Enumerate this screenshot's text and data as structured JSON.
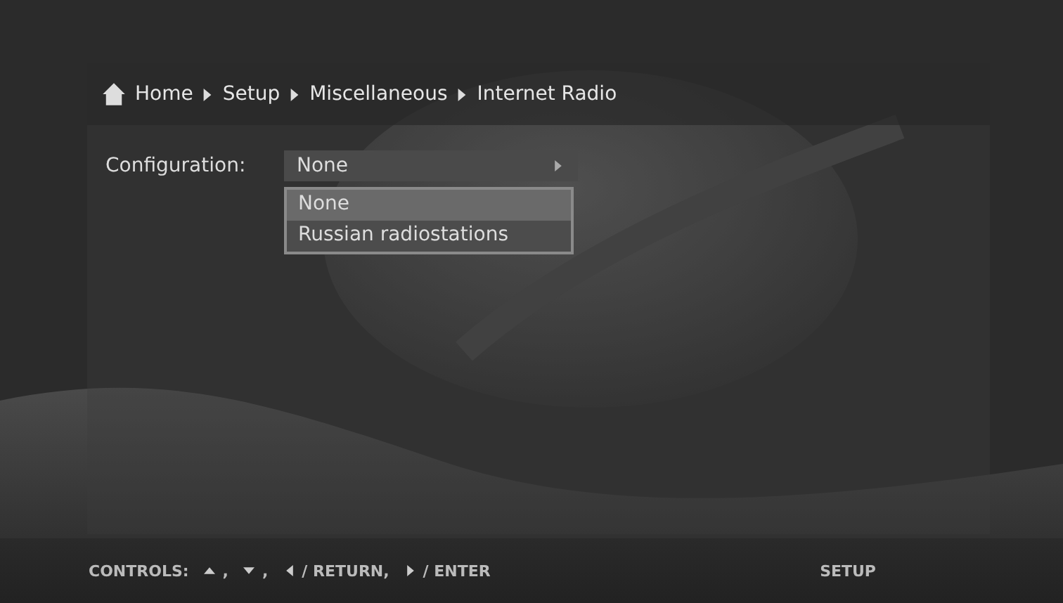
{
  "breadcrumb": [
    "Home",
    "Setup",
    "Miscellaneous",
    "Internet Radio"
  ],
  "setting": {
    "label": "Configuration:",
    "value": "None",
    "expanded": true,
    "options": [
      {
        "label": "None",
        "selected": true
      },
      {
        "label": "Russian radiostations",
        "selected": false
      }
    ]
  },
  "footer": {
    "label": "CONTROLS:",
    "hints": [
      {
        "kind": "up",
        "text": ","
      },
      {
        "kind": "down",
        "text": ","
      },
      {
        "kind": "left",
        "text": "/ RETURN,"
      },
      {
        "kind": "right",
        "text": "/ ENTER"
      }
    ],
    "section": "SETUP"
  }
}
